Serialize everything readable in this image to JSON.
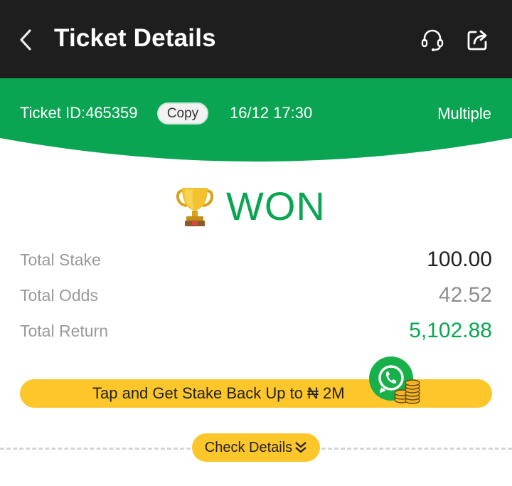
{
  "header": {
    "title": "Ticket Details",
    "back_icon": "chevron-left-icon",
    "support_icon": "headset-icon",
    "share_icon": "share-icon"
  },
  "ticket": {
    "id_text": "Ticket ID:465359",
    "copy_label": "Copy",
    "datetime": "16/12 17:30",
    "type": "Multiple"
  },
  "status": {
    "label": "WON",
    "icon": "trophy-icon"
  },
  "summary": [
    {
      "label": "Total Stake",
      "value": "100.00"
    },
    {
      "label": "Total Odds",
      "value": "42.52"
    },
    {
      "label": "Total Return",
      "value": "5,102.88"
    }
  ],
  "promo": {
    "text": "Tap and Get Stake Back Up to ₦ 2M",
    "badge_icon": "whatsapp-coins-icon"
  },
  "check_details": {
    "label": "Check Details",
    "icon": "double-chevron-down-icon"
  },
  "colors": {
    "header_bg": "#1e1e1e",
    "green": "#0aa552",
    "yellow": "#fdc62b"
  }
}
